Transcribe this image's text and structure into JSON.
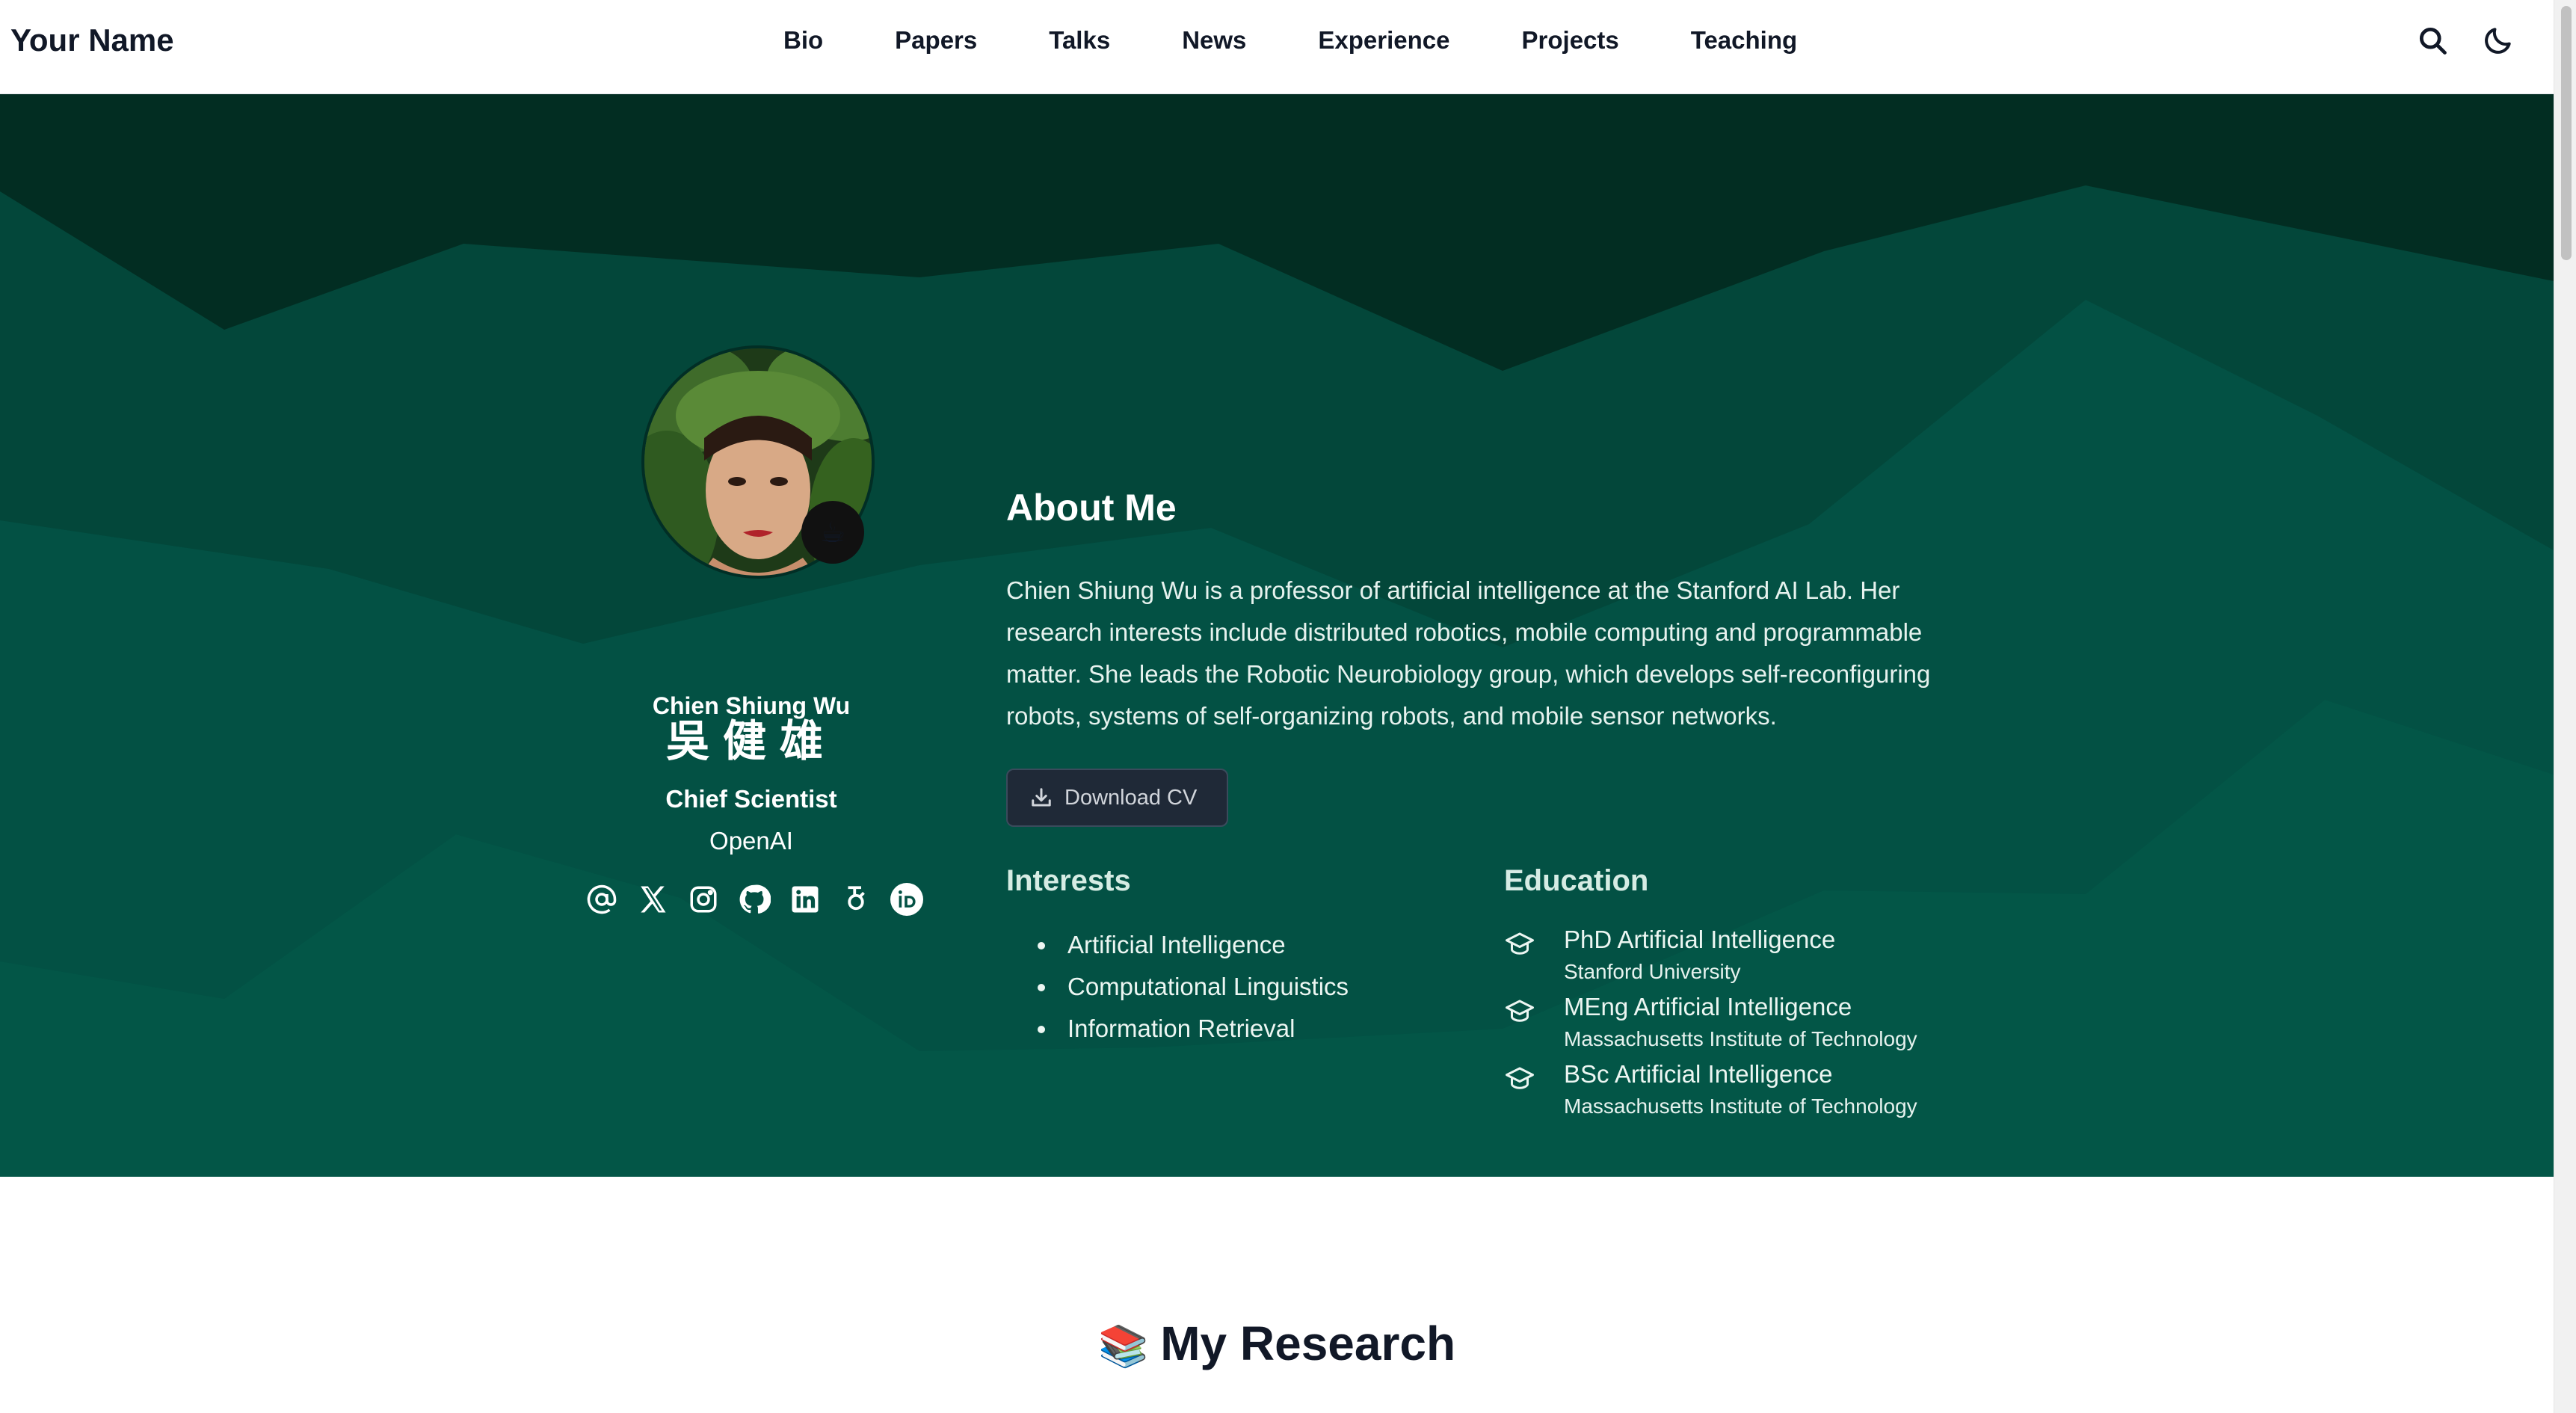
{
  "header": {
    "brand": "Your Name",
    "nav": [
      {
        "label": "Bio"
      },
      {
        "label": "Papers"
      },
      {
        "label": "Talks"
      },
      {
        "label": "News"
      },
      {
        "label": "Experience"
      },
      {
        "label": "Projects"
      },
      {
        "label": "Teaching"
      }
    ],
    "icons": [
      "search-icon",
      "moon-icon"
    ]
  },
  "profile": {
    "name": "Chien Shiung Wu",
    "name_cn": "吳健雄",
    "role": "Chief Scientist",
    "organization": "OpenAI",
    "avatar_badge": "☕",
    "socials": [
      "at-icon",
      "x-icon",
      "instagram-icon",
      "github-icon",
      "linkedin-icon",
      "google-scholar-icon",
      "orcid-icon"
    ]
  },
  "about": {
    "title": "About Me",
    "text": "Chien Shiung Wu is a professor of artificial intelligence at the Stanford AI Lab. Her research interests include distributed robotics, mobile computing and programmable matter. She leads the Robotic Neurobiology group, which develops self-reconfiguring robots, systems of self-organizing robots, and mobile sensor networks.",
    "cv_label": "Download CV"
  },
  "interests": {
    "title": "Interests",
    "items": [
      "Artificial Intelligence",
      "Computational Linguistics",
      "Information Retrieval"
    ]
  },
  "education": {
    "title": "Education",
    "items": [
      {
        "degree": "PhD Artificial Intelligence",
        "school": "Stanford University"
      },
      {
        "degree": "MEng Artificial Intelligence",
        "school": "Massachusetts Institute of Technology"
      },
      {
        "degree": "BSc Artificial Intelligence",
        "school": "Massachusetts Institute of Technology"
      }
    ]
  },
  "research": {
    "emoji": "📚",
    "title": "My Research"
  },
  "colors": {
    "hero_dark": "#022d22",
    "hero_mid": "#03473a",
    "hero_base": "#035647",
    "button_bg": "#1f2937"
  }
}
